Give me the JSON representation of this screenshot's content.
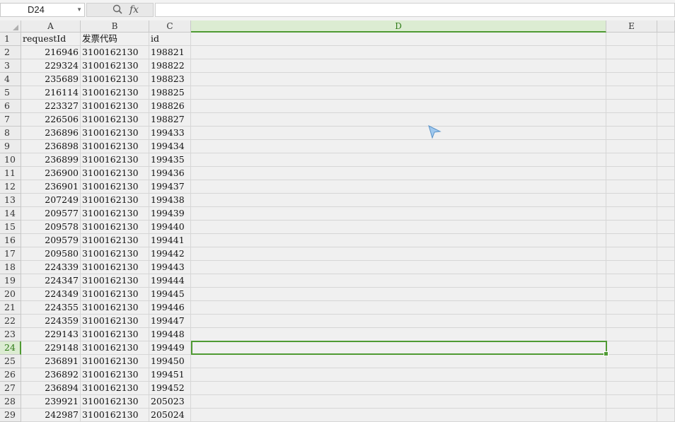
{
  "name_box": {
    "value": "D24"
  },
  "formula_bar": {
    "fx_label": "fx",
    "value": ""
  },
  "columns": [
    "A",
    "B",
    "C",
    "D",
    "E"
  ],
  "selected_column": "D",
  "selected_row": "24",
  "active_cell": "D24",
  "header_row": {
    "row": "1",
    "A": "requestId",
    "B": "发票代码",
    "C": "id"
  },
  "rows": [
    {
      "row": "2",
      "A": "216946",
      "B": "3100162130",
      "C": "198821"
    },
    {
      "row": "3",
      "A": "229324",
      "B": "3100162130",
      "C": "198822"
    },
    {
      "row": "4",
      "A": "235689",
      "B": "3100162130",
      "C": "198823"
    },
    {
      "row": "5",
      "A": "216114",
      "B": "3100162130",
      "C": "198825"
    },
    {
      "row": "6",
      "A": "223327",
      "B": "3100162130",
      "C": "198826"
    },
    {
      "row": "7",
      "A": "226506",
      "B": "3100162130",
      "C": "198827"
    },
    {
      "row": "8",
      "A": "236896",
      "B": "3100162130",
      "C": "199433"
    },
    {
      "row": "9",
      "A": "236898",
      "B": "3100162130",
      "C": "199434"
    },
    {
      "row": "10",
      "A": "236899",
      "B": "3100162130",
      "C": "199435"
    },
    {
      "row": "11",
      "A": "236900",
      "B": "3100162130",
      "C": "199436"
    },
    {
      "row": "12",
      "A": "236901",
      "B": "3100162130",
      "C": "199437"
    },
    {
      "row": "13",
      "A": "207249",
      "B": "3100162130",
      "C": "199438"
    },
    {
      "row": "14",
      "A": "209577",
      "B": "3100162130",
      "C": "199439"
    },
    {
      "row": "15",
      "A": "209578",
      "B": "3100162130",
      "C": "199440"
    },
    {
      "row": "16",
      "A": "209579",
      "B": "3100162130",
      "C": "199441"
    },
    {
      "row": "17",
      "A": "209580",
      "B": "3100162130",
      "C": "199442"
    },
    {
      "row": "18",
      "A": "224339",
      "B": "3100162130",
      "C": "199443"
    },
    {
      "row": "19",
      "A": "224347",
      "B": "3100162130",
      "C": "199444"
    },
    {
      "row": "20",
      "A": "224349",
      "B": "3100162130",
      "C": "199445"
    },
    {
      "row": "21",
      "A": "224355",
      "B": "3100162130",
      "C": "199446"
    },
    {
      "row": "22",
      "A": "224359",
      "B": "3100162130",
      "C": "199447"
    },
    {
      "row": "23",
      "A": "229143",
      "B": "3100162130",
      "C": "199448"
    },
    {
      "row": "24",
      "A": "229148",
      "B": "3100162130",
      "C": "199449"
    },
    {
      "row": "25",
      "A": "236891",
      "B": "3100162130",
      "C": "199450"
    },
    {
      "row": "26",
      "A": "236892",
      "B": "3100162130",
      "C": "199451"
    },
    {
      "row": "27",
      "A": "236894",
      "B": "3100162130",
      "C": "199452"
    },
    {
      "row": "28",
      "A": "239921",
      "B": "3100162130",
      "C": "205023"
    },
    {
      "row": "29",
      "A": "242987",
      "B": "3100162130",
      "C": "205024"
    }
  ],
  "colors": {
    "accent": "#4f9a33",
    "grid": "#d6d6d6",
    "background": "#f0f0f0"
  },
  "icons": {
    "zoom": "zoom-icon",
    "formula": "fx-icon",
    "cursor": "arrow-cursor-icon"
  }
}
